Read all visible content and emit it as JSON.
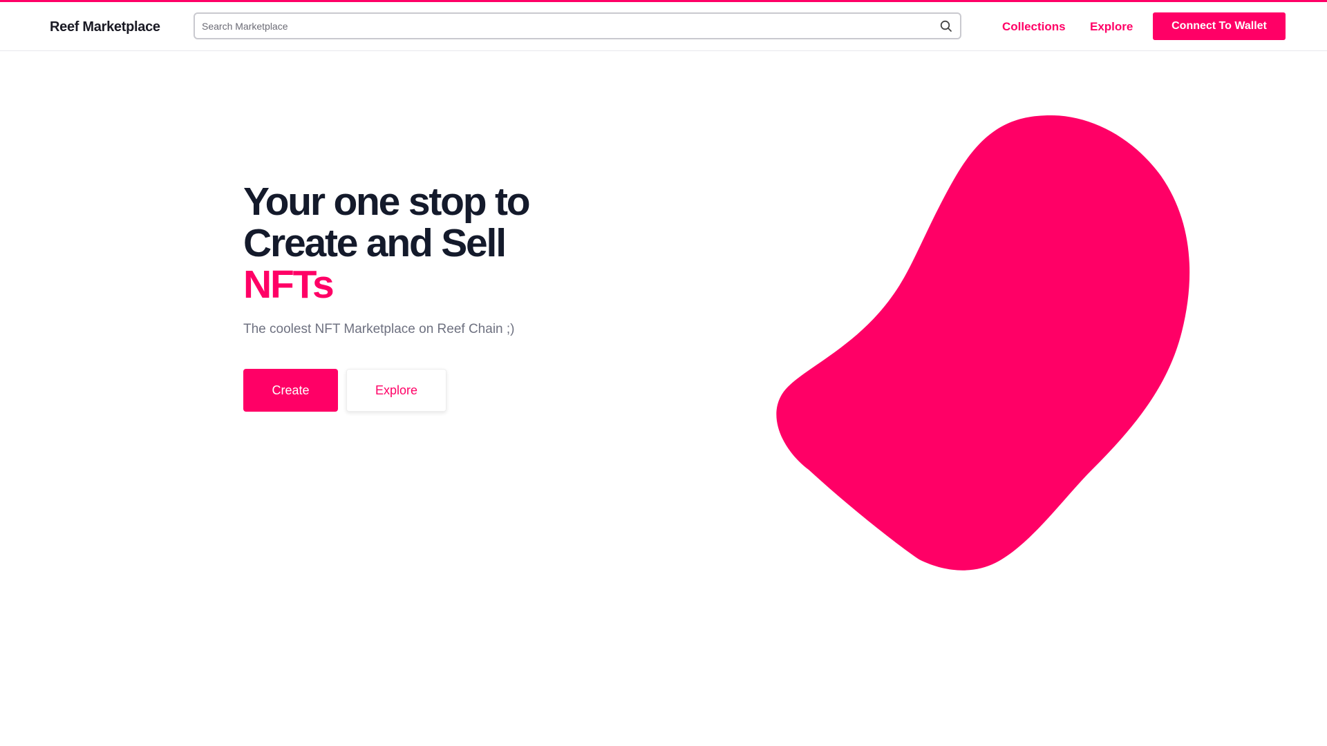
{
  "header": {
    "brand": "Reef Marketplace",
    "search_placeholder": "Search Marketplace",
    "search_value": "",
    "nav": {
      "collections": "Collections",
      "explore": "Explore"
    },
    "connect_label": "Connect To Wallet"
  },
  "hero": {
    "title_line1": "Your one stop to",
    "title_line2": "Create and Sell",
    "title_accent": "NFTs",
    "subtitle": "The coolest NFT Marketplace on Reef Chain ;)",
    "create_label": "Create",
    "explore_label": "Explore"
  },
  "colors": {
    "accent": "#ff0066",
    "heading": "#141a2b",
    "subtitle": "#6e7180"
  },
  "icons": {
    "search": "search-icon"
  }
}
